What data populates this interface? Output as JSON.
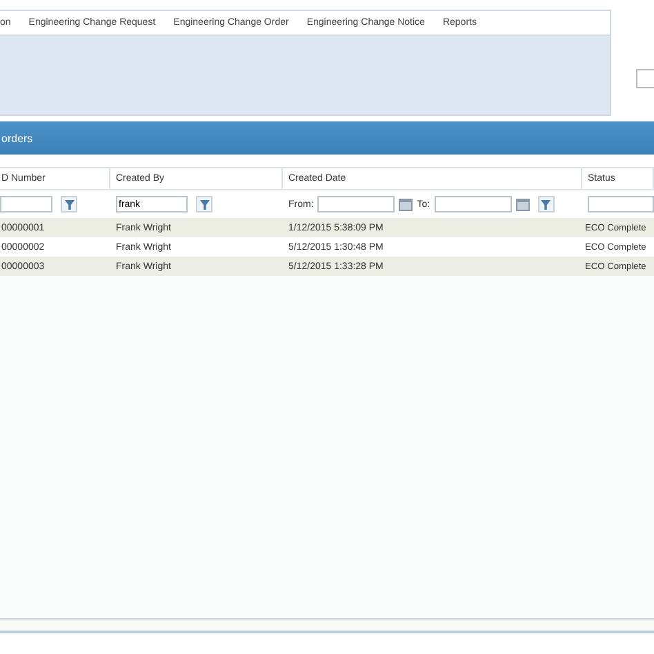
{
  "menu": [
    "on",
    "Engineering Change Request",
    "Engineering Change Order",
    "Engineering Change Notice",
    "Reports"
  ],
  "panel_title": "orders",
  "table": {
    "columns": [
      "D Number",
      "Created By",
      "Created Date",
      "Status"
    ],
    "filters": {
      "created_by": "frank",
      "from_label": "From:",
      "to_label": "To:"
    },
    "rows": [
      {
        "cells": [
          "00000001",
          "Frank Wright",
          "1/12/2015 5:38:09 PM",
          "ECO Complete"
        ]
      },
      {
        "cells": [
          "00000002",
          "Frank Wright",
          "5/12/2015 1:30:48 PM",
          "ECO Complete"
        ]
      },
      {
        "cells": [
          "00000003",
          "Frank Wright",
          "5/12/2015 1:33:28 PM",
          "ECO Complete"
        ]
      }
    ]
  }
}
